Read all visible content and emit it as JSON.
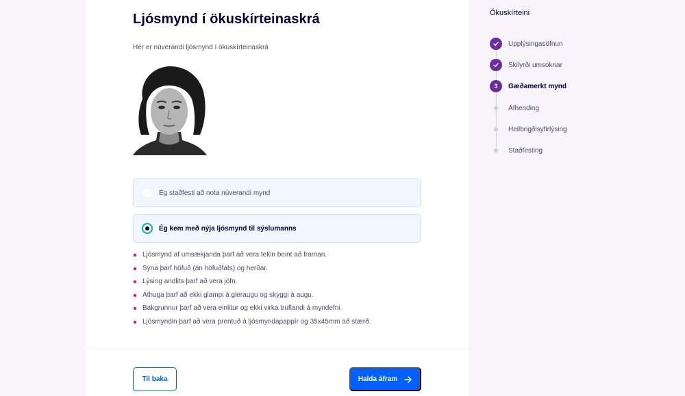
{
  "main": {
    "title": "Ljósmynd í ökuskírteinaskrá",
    "intro": "Hér er núverandi ljósmynd í ökuskírteinaskrá",
    "options": [
      {
        "label": "Ég staðfesti að nota núverandi mynd",
        "selected": false
      },
      {
        "label": "Ég kem með nýja ljósmynd til sýslumanns",
        "selected": true
      }
    ],
    "requirements": [
      "Ljósmynd af umsækjanda þarf að vera tekin beint að framan.",
      "Sýna þarf höfuð (án höfuðfats) og herðar.",
      "Lýsing andlits þarf að vera jöfn.",
      "Athuga þarf að ekki glampi á gleraugu og skyggi á augu.",
      "Bakgrunnur þarf að vera einlitur og ekki virka truflandi á myndefni.",
      "Ljósmyndin þarf að vera prentuð á ljósmyndapappír og 35x45mm að stærð."
    ]
  },
  "footer": {
    "back_label": "Til baka",
    "next_label": "Halda áfram"
  },
  "sidebar": {
    "title": "Ökuskírteini",
    "steps": [
      {
        "label": "Upplýsingasöfnun",
        "state": "done"
      },
      {
        "label": "Skilyrði umsóknar",
        "state": "done"
      },
      {
        "label": "Gæðamerkt mynd",
        "state": "current",
        "number": "3"
      },
      {
        "label": "Afhending",
        "state": "todo"
      },
      {
        "label": "Heilbrigðisyfirlýsing",
        "state": "todo"
      },
      {
        "label": "Staðfesting",
        "state": "todo"
      }
    ]
  },
  "colors": {
    "primary": "#0061ff",
    "accent_purple": "#6a2ea0",
    "bullet_red": "#ff0050",
    "radio_teal": "#00b39e",
    "text_dark": "#00003c"
  },
  "icons": {
    "check": "check-icon",
    "arrow": "arrow-right-icon"
  }
}
